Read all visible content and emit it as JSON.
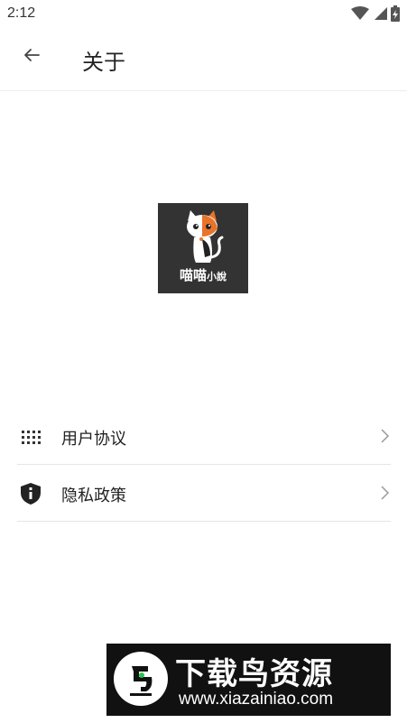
{
  "status_bar": {
    "time": "2:12",
    "icons": [
      "wifi-icon",
      "signal-icon",
      "battery-charging-icon"
    ]
  },
  "app_bar": {
    "back_icon": "arrow-left-icon",
    "title": "关于"
  },
  "logo": {
    "text_main": "喵喵",
    "text_small": "小說",
    "background": "#333333"
  },
  "menu": {
    "items": [
      {
        "icon": "grid-dots-icon",
        "label": "用户协议",
        "chevron": "chevron-right-icon"
      },
      {
        "icon": "shield-info-icon",
        "label": "隐私政策",
        "chevron": "chevron-right-icon"
      }
    ]
  },
  "watermark": {
    "title": "下载鸟资源",
    "url": "www.xiazainiao.com"
  },
  "colors": {
    "text": "#222222",
    "divider": "#e6e6e6",
    "icon": "#333333",
    "watermark_bg": "#111111",
    "logo_orange": "#e8742a"
  }
}
